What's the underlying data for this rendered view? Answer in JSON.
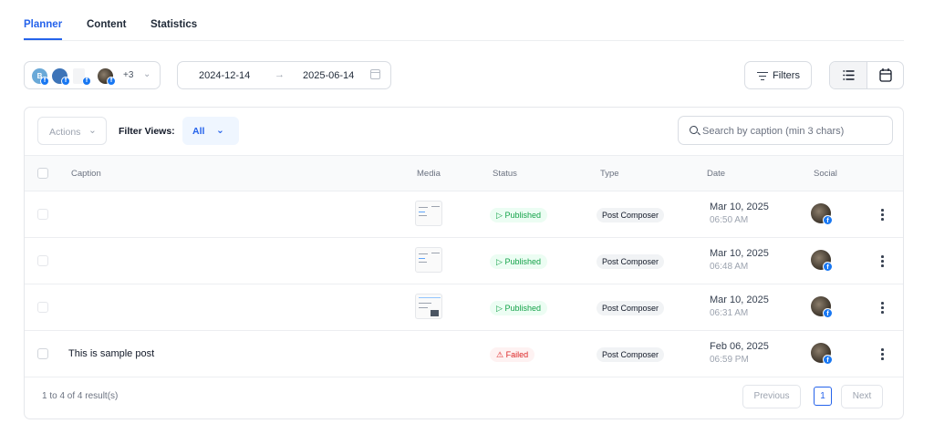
{
  "tabs": [
    {
      "label": "Planner",
      "active": true
    },
    {
      "label": "Content",
      "active": false
    },
    {
      "label": "Statistics",
      "active": false
    }
  ],
  "accounts": {
    "avatars": [
      {
        "letter": "B",
        "color": "#6aa9d8"
      },
      {
        "letter": "",
        "color": "#3d74b8"
      },
      {
        "letter": "",
        "color": "#e5e7eb"
      },
      {
        "letter": "",
        "color": "#5a4c3c"
      }
    ],
    "extra_count": "+3"
  },
  "date_range": {
    "start": "2024-12-14",
    "end": "2025-06-14"
  },
  "filters_label": "Filters",
  "table_toolbar": {
    "actions_label": "Actions",
    "filter_views_label": "Filter Views:",
    "filter_views_value": "All",
    "search_placeholder": "Search by caption (min 3 chars)"
  },
  "columns": [
    "Caption",
    "Media",
    "Status",
    "Type",
    "Date",
    "Social"
  ],
  "rows": [
    {
      "caption": "",
      "status": "Published",
      "status_kind": "published",
      "type": "Post Composer",
      "date": "Mar 10, 2025",
      "time": "06:50 AM"
    },
    {
      "caption": "",
      "status": "Published",
      "status_kind": "published",
      "type": "Post Composer",
      "date": "Mar 10, 2025",
      "time": "06:48 AM"
    },
    {
      "caption": "",
      "status": "Published",
      "status_kind": "published",
      "type": "Post Composer",
      "date": "Mar 10, 2025",
      "time": "06:31 AM"
    },
    {
      "caption": "This is sample post",
      "status": "Failed",
      "status_kind": "failed",
      "type": "Post Composer",
      "date": "Feb 06, 2025",
      "time": "06:59 PM"
    }
  ],
  "footer": {
    "result_text": "1 to 4 of 4 result(s)",
    "previous_label": "Previous",
    "current_page": "1",
    "next_label": "Next"
  },
  "colors": {
    "accent": "#2563eb",
    "published": "#16a34a",
    "failed": "#dc2626",
    "facebook": "#1877f2"
  },
  "icons": {
    "published": "▷",
    "failed": "⚠",
    "chevron": "⌄",
    "arrow": "→"
  }
}
